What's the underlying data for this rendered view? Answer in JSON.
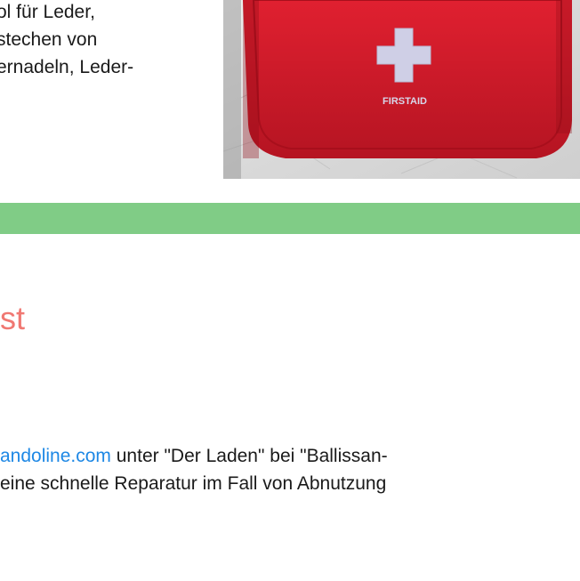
{
  "intro": {
    "line1": "ol für Leder,",
    "line2": "stechen von",
    "line3": "ernadeln, Leder-"
  },
  "image": {
    "label": "FIRSTAID",
    "bag_color": "#d61a2a",
    "cross_color": "#cfcfe6"
  },
  "band": {
    "color": "#80cc86"
  },
  "section": {
    "heading": "st",
    "heading_color": "#f07872"
  },
  "body": {
    "link_text": "andoline.com",
    "line1_rest": " unter \"Der Laden\" bei \"Ballissan-",
    "line2": "eine schnelle Reparatur im Fall von Abnutzung"
  }
}
